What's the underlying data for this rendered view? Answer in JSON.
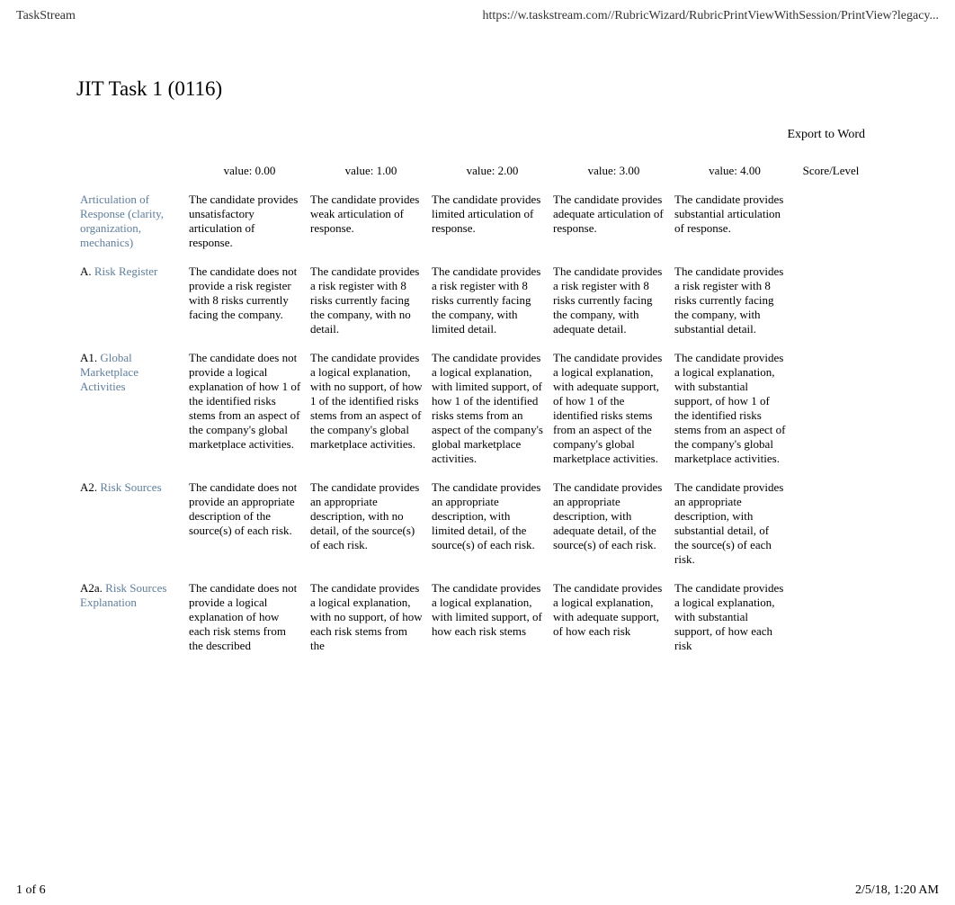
{
  "browser_header": {
    "left": "TaskStream",
    "right": "https://w.taskstream.com//RubricWizard/RubricPrintViewWithSession/PrintView?legacy..."
  },
  "title": "JIT Task 1 (0116)",
  "export_label": "Export to Word",
  "headers": {
    "c0": "",
    "c1": "value: 0.00",
    "c2": "value: 1.00",
    "c3": "value: 2.00",
    "c4": "value: 3.00",
    "c5": "value: 4.00",
    "c6": "Score/Level"
  },
  "rows": [
    {
      "prefix": "",
      "criterion": "Articulation of Response (clarity, organization, mechanics)",
      "c1": "The candidate provides unsatisfactory articulation of response.",
      "c2": "The candidate provides weak articulation of response.",
      "c3": "The candidate provides limited articulation of response.",
      "c4": "The candidate provides adequate articulation of response.",
      "c5": "The candidate provides substantial articulation of response.",
      "score": ""
    },
    {
      "prefix": "A. ",
      "criterion": "Risk Register",
      "c1": "The candidate does not provide a risk register with 8 risks currently facing the company.",
      "c2": "The candidate provides a risk register with 8 risks currently facing the company, with no detail.",
      "c3": "The candidate provides a risk register with 8 risks currently facing the company, with limited detail.",
      "c4": "The candidate provides a risk register with 8 risks currently facing the company, with adequate detail.",
      "c5": "The candidate provides a risk register with 8 risks currently facing the company, with substantial detail.",
      "score": ""
    },
    {
      "prefix": "A1. ",
      "criterion": "Global Marketplace Activities",
      "c1": "The candidate does not provide a logical explanation of how 1 of the identified risks stems from an aspect of the company's global marketplace activities.",
      "c2": "The candidate provides a logical explanation, with no support, of how 1 of the identified risks stems from an aspect of the company's global marketplace activities.",
      "c3": "The candidate provides a logical explanation, with limited support, of how 1 of the identified risks stems from an aspect of the company's global marketplace activities.",
      "c4": "The candidate provides a logical explanation, with adequate support, of how 1 of the identified risks stems from an aspect of the company's global marketplace activities.",
      "c5": "The candidate provides a logical explanation, with substantial support, of how 1 of the identified risks stems from an aspect of the company's global marketplace activities.",
      "score": ""
    },
    {
      "prefix": "A2. ",
      "criterion": "Risk Sources",
      "c1": "The candidate does not provide an appropriate description of the source(s) of  each risk.",
      "c2": "The candidate provides an appropriate description, with no detail, of the source(s) of  each risk.",
      "c3": "The candidate provides an appropriate description, with limited detail, of the source(s) of  each risk.",
      "c4": "The candidate provides an appropriate description, with adequate detail, of the source(s) of  each risk.",
      "c5": "The candidate provides an appropriate description, with substantial detail, of the source(s) of  each risk.",
      "score": ""
    },
    {
      "prefix": "A2a. ",
      "criterion": "Risk Sources Explanation",
      "c1": "The candidate does not provide a logical explanation of how each risk stems from the described",
      "c2": "The candidate provides a logical explanation, with no support, of how  each risk stems from the",
      "c3": "The candidate provides a logical explanation, with limited support, of how  each risk stems",
      "c4": "The candidate provides a logical explanation, with adequate support, of how each  risk",
      "c5": "The candidate provides a logical explanation, with substantial support, of how  each risk",
      "score": ""
    }
  ],
  "footer": {
    "left": "1 of 6",
    "right": "2/5/18, 1:20 AM"
  }
}
